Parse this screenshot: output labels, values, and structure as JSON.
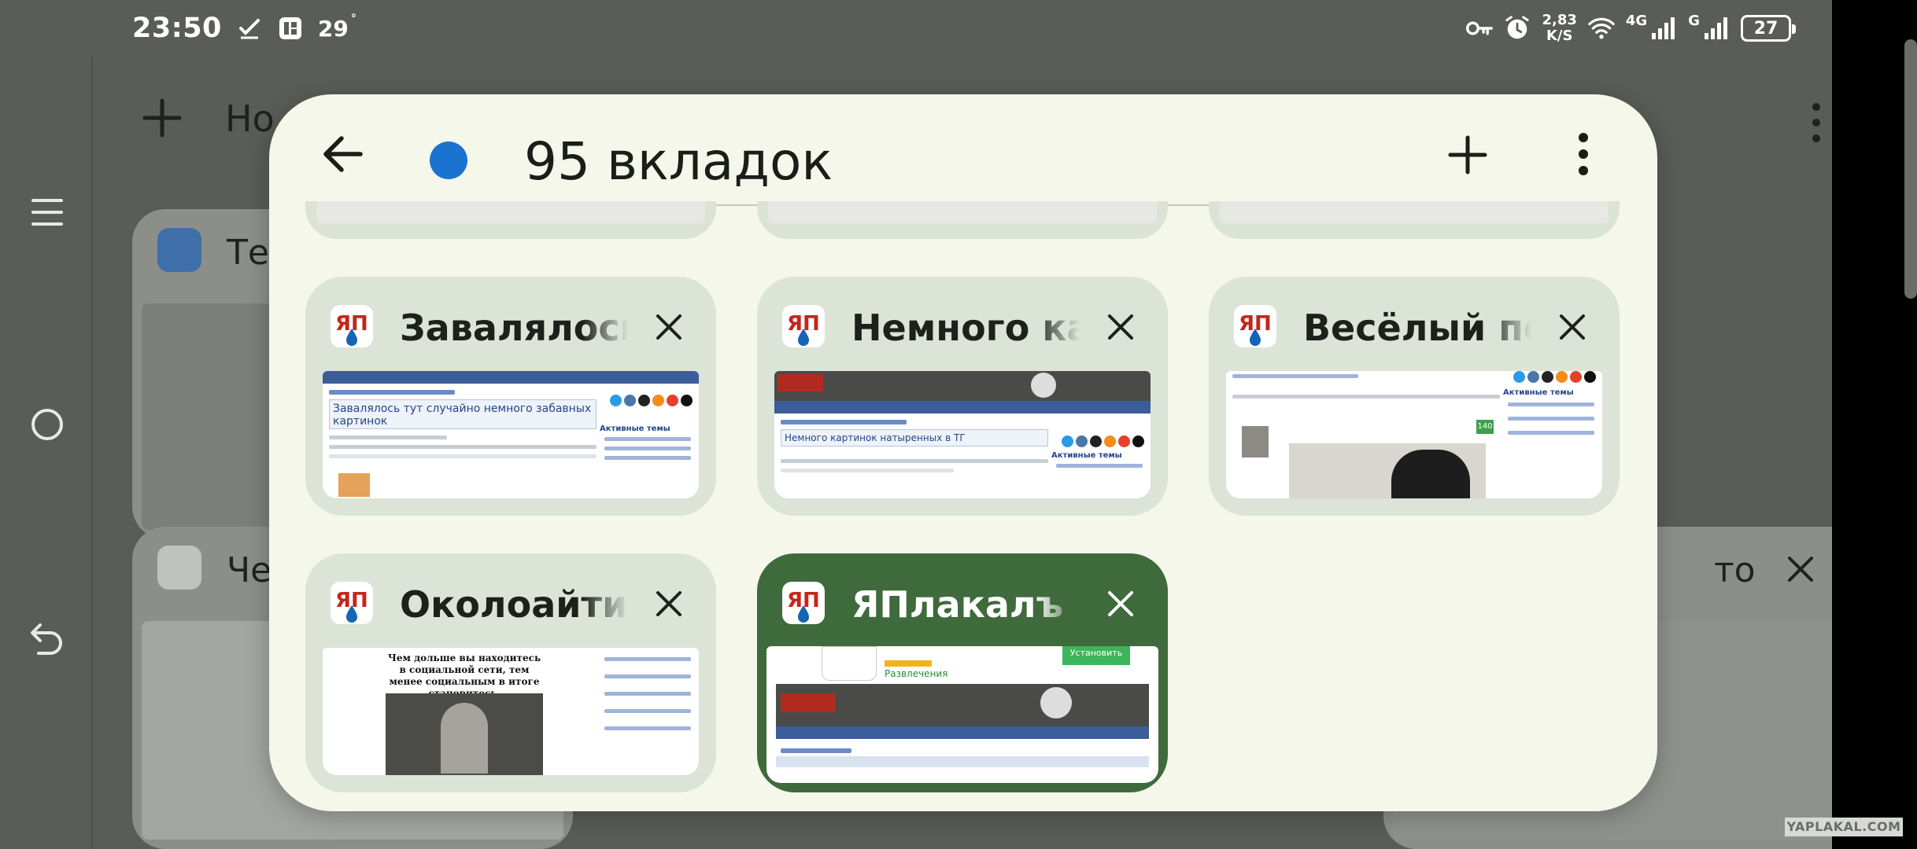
{
  "status_bar": {
    "time": "23:50",
    "temperature": "29",
    "temperature_unit": "°",
    "net_speed_value": "2,83",
    "net_speed_unit": "K/S",
    "network_type": "4G",
    "network_type_2": "G",
    "battery": "27",
    "icons": [
      "check-icon",
      "news-app-icon",
      "key-icon",
      "alarm-icon",
      "wifi-icon",
      "signal-icon",
      "signal-2-icon",
      "battery-icon"
    ]
  },
  "nav_rail": {
    "icons": [
      "menu-icon",
      "home-circle-icon",
      "back-icon"
    ]
  },
  "background": {
    "title_partial": "Но",
    "cards": [
      {
        "title_partial": "Те"
      },
      {
        "title_partial": "Че"
      },
      {
        "title_partial": "то"
      }
    ]
  },
  "dialog": {
    "title": "95 вкладок",
    "group_color": "#1a73d0",
    "tabs": [
      {
        "title": "Завалялось тут случайно немного забавных картинок",
        "selected": false
      },
      {
        "title": "Немного картинок натыренных в ТГ",
        "selected": false
      },
      {
        "title": "Весёлый понтишок",
        "selected": false
      },
      {
        "title": "Околоайтишное",
        "selected": false
      },
      {
        "title": "ЯПлакалъ – Развлечения",
        "selected": true
      }
    ],
    "thumb_texts": {
      "tab1_heading": "Завалялось тут случайно немного забавных картинок",
      "tab2_heading": "Немного картинок натыренных в ТГ",
      "tab4_caption": "Чем дольше вы находитесь в социальной сети, тем менее социальным в итоге становитесь.",
      "tab5_install": "Установить",
      "tab5_category": "Развлечения",
      "side_active": "Активные темы",
      "tab3_badge": "140"
    }
  },
  "watermark": "YAPLAKAL.COM",
  "colors": {
    "dialog_bg": "#f4f7ea",
    "card_bg": "#dbe4d6",
    "selected_card_bg": "#3e6a3c",
    "scrim": "#5a5c57"
  }
}
